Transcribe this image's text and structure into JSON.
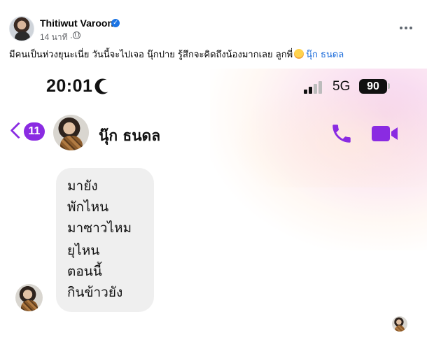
{
  "post": {
    "author_name": "Thitiwut Varoon",
    "time_ago": "14 นาที ·",
    "caption_text": "มีคนเป็นห่วงยุนะเนี่ย วันนี้จะไปเจอ นุ๊กปาย รู้สึกจะคิดถึงน้องมากเลย ลูกพี่",
    "tagged_person": "นุ๊ก ธนดล",
    "icons": [
      "verified-badge-icon",
      "globe-icon",
      "more-options-icon",
      "emoji-icon"
    ]
  },
  "phone_screenshot": {
    "status_bar": {
      "time": "20:01",
      "network": "5G",
      "battery_level": "90"
    },
    "chat_header": {
      "back_count": "11",
      "contact_name": "นุ๊ก ธนดล",
      "icons": [
        "back-chevron-icon",
        "phone-call-icon",
        "video-call-icon"
      ]
    },
    "messages": [
      "มายัง",
      "พักไหน",
      "มาซาวไหม",
      "ยุไหน",
      "ตอนนี้",
      "กินข้าวยัง"
    ],
    "colors": {
      "accent": "#8a2be2",
      "bubble": "#efefef"
    }
  }
}
